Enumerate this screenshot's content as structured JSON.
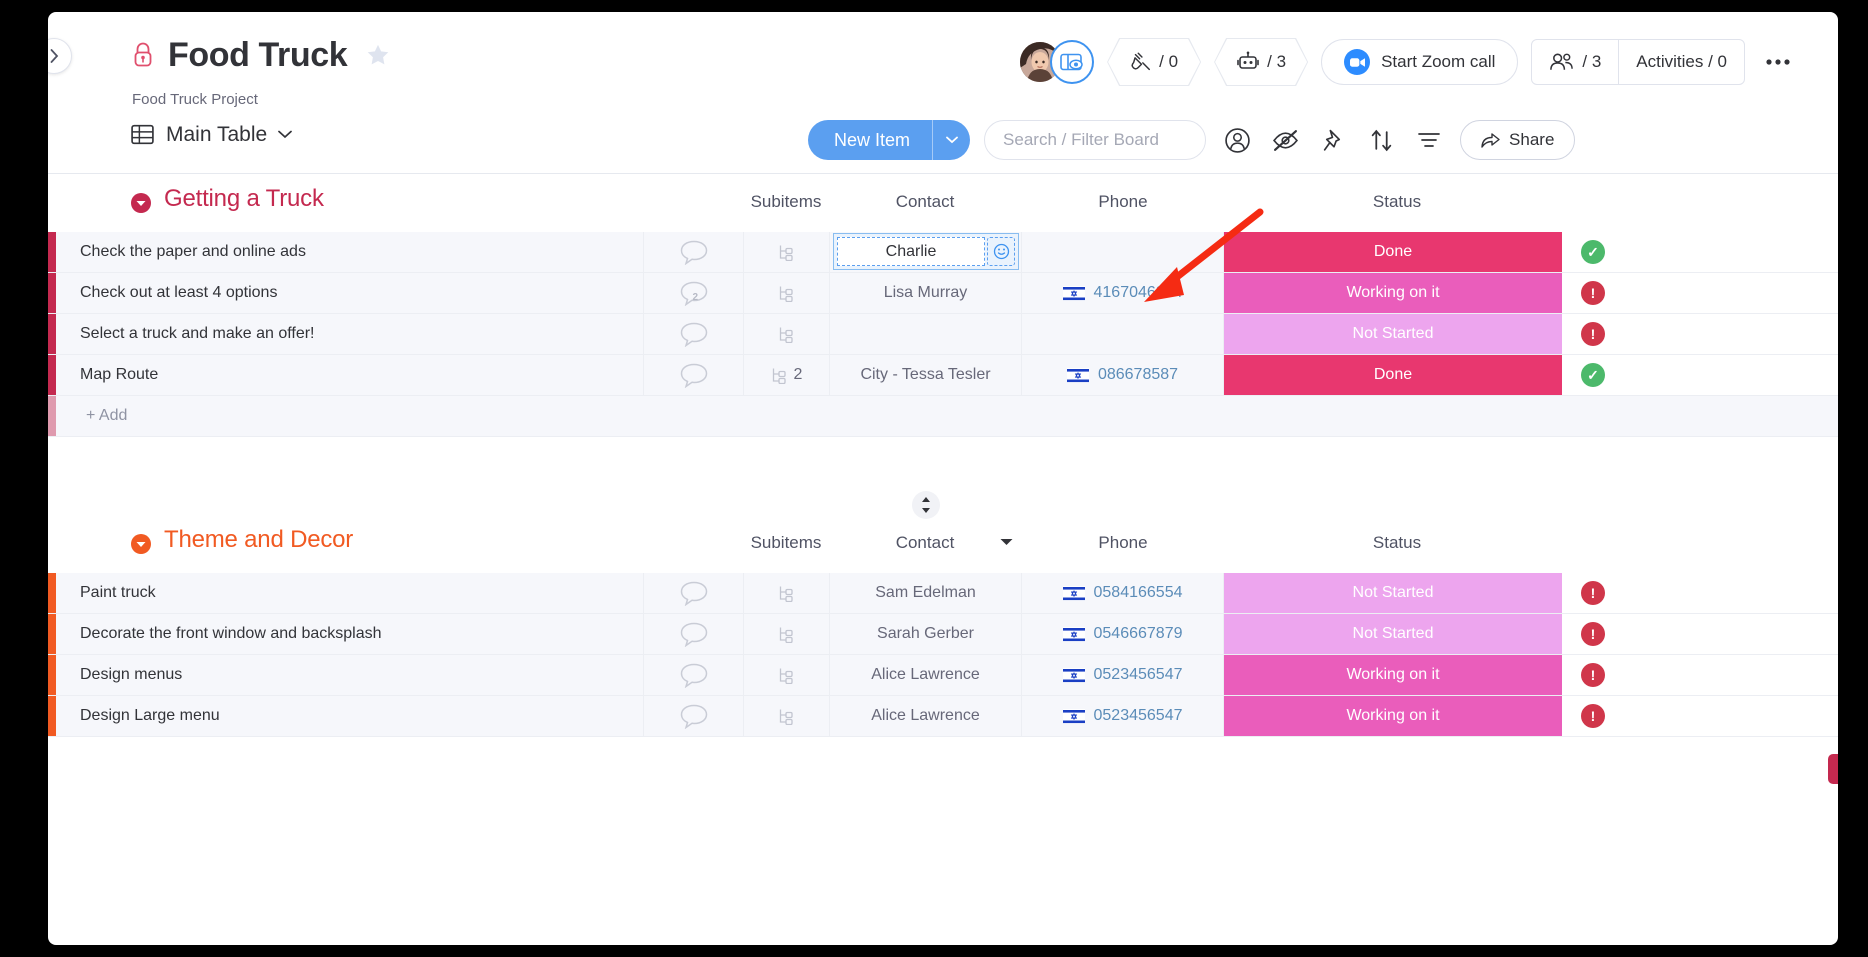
{
  "header": {
    "collapse_icon": "chevron-right-icon",
    "lock_icon": "lock-icon",
    "title": "Food Truck",
    "star_icon": "star-icon",
    "subtitle": "Food Truck Project",
    "avatar_icon": "user-avatar",
    "view_badge_icon": "board-view-eye-icon",
    "integrations": {
      "icon": "plug-icon",
      "label": "/ 0"
    },
    "automations": {
      "icon": "robot-icon",
      "label": "/ 3"
    },
    "zoom_call": {
      "icon": "video-camera-icon",
      "label": "Start Zoom call"
    },
    "people": {
      "icon": "people-icon",
      "label": "/ 3"
    },
    "activities": {
      "label": "Activities / 0"
    },
    "more_icon": "ellipsis-icon"
  },
  "toolbar": {
    "view_icon": "table-grid-icon",
    "view_label": "Main Table",
    "view_caret_icon": "chevron-down-icon",
    "new_item_label": "New Item",
    "new_item_caret_icon": "chevron-down-icon",
    "search_placeholder": "Search / Filter Board",
    "search_value": "",
    "person_icon": "person-circle-icon",
    "hide_icon": "eye-slash-icon",
    "pin_icon": "pin-icon",
    "sort_icon": "sort-icon",
    "filter_icon": "filter-icon",
    "share_icon": "share-arrow-icon",
    "share_label": "Share"
  },
  "columns": {
    "subitems": "Subitems",
    "contact": "Contact",
    "phone": "Phone",
    "status": "Status"
  },
  "colors": {
    "group_1": "#c4294f",
    "group_2": "#f15a22",
    "status_done": "#e8376f",
    "status_working": "#ea5dbb",
    "status_not_started": "#eda5ee",
    "accent_blue": "#5b9ff0",
    "indicator_done": "#4cb96b",
    "indicator_alert": "#d0364a"
  },
  "groups": [
    {
      "name": "Getting a Truck",
      "color": "#c4294f",
      "caret_icon": "collapse-caret-icon",
      "sort_handle": false,
      "add_label": "+ Add",
      "rows": [
        {
          "name": "Check the paper and online ads",
          "chat_icon": "chat-bubble-icon",
          "chat_count": "",
          "subitem_icon": "subitem-tree-icon",
          "subitem_count": "",
          "contact": "Charlie",
          "contact_editing": true,
          "contact_emoji_icon": "smiley-icon",
          "phone": "",
          "phone_flag_icon": "",
          "status": "Done",
          "status_color": "#e8376f",
          "indicator": "done"
        },
        {
          "name": "Check out at least 4 options",
          "chat_icon": "chat-bubble-icon",
          "chat_count": "2",
          "subitem_icon": "subitem-tree-icon",
          "subitem_count": "",
          "contact": "Lisa Murray",
          "contact_editing": false,
          "phone": "4167046964",
          "phone_flag_icon": "israel-flag-icon",
          "status": "Working on it",
          "status_color": "#ea5dbb",
          "indicator": "alert"
        },
        {
          "name": "Select a truck and make an offer!",
          "chat_icon": "chat-bubble-icon",
          "chat_count": "",
          "subitem_icon": "subitem-tree-icon",
          "subitem_count": "",
          "contact": "",
          "contact_editing": false,
          "phone": "",
          "phone_flag_icon": "",
          "status": "Not Started",
          "status_color": "#eda5ee",
          "indicator": "alert"
        },
        {
          "name": "Map Route",
          "chat_icon": "chat-bubble-icon",
          "chat_count": "",
          "subitem_icon": "subitem-tree-icon",
          "subitem_count": "2",
          "contact": "City - Tessa Tesler",
          "contact_editing": false,
          "phone": "086678587",
          "phone_flag_icon": "israel-flag-icon",
          "status": "Done",
          "status_color": "#e8376f",
          "indicator": "done"
        }
      ]
    },
    {
      "name": "Theme and Decor",
      "color": "#f15a22",
      "caret_icon": "collapse-caret-icon",
      "sort_handle": true,
      "sort_handle_icon": "sort-updown-icon",
      "column_caret_icon": "chevron-down-icon",
      "add_label": "",
      "rows": [
        {
          "name": "Paint truck",
          "chat_icon": "chat-bubble-icon",
          "chat_count": "",
          "subitem_icon": "subitem-tree-icon",
          "subitem_count": "",
          "contact": "Sam Edelman",
          "contact_editing": false,
          "phone": "0584166554",
          "phone_flag_icon": "israel-flag-icon",
          "status": "Not Started",
          "status_color": "#eda5ee",
          "indicator": "alert"
        },
        {
          "name": "Decorate the front window and backsplash",
          "chat_icon": "chat-bubble-icon",
          "chat_count": "",
          "subitem_icon": "subitem-tree-icon",
          "subitem_count": "",
          "contact": "Sarah Gerber",
          "contact_editing": false,
          "phone": "0546667879",
          "phone_flag_icon": "israel-flag-icon",
          "status": "Not Started",
          "status_color": "#eda5ee",
          "indicator": "alert"
        },
        {
          "name": "Design menus",
          "chat_icon": "chat-bubble-icon",
          "chat_count": "",
          "subitem_icon": "subitem-tree-icon",
          "subitem_count": "",
          "contact": "Alice Lawrence",
          "contact_editing": false,
          "phone": "0523456547",
          "phone_flag_icon": "israel-flag-icon",
          "status": "Working on it",
          "status_color": "#ea5dbb",
          "indicator": "alert"
        },
        {
          "name": "Design Large menu",
          "chat_icon": "chat-bubble-icon",
          "chat_count": "",
          "subitem_icon": "subitem-tree-icon",
          "subitem_count": "",
          "contact": "Alice Lawrence",
          "contact_editing": false,
          "phone": "0523456547",
          "phone_flag_icon": "israel-flag-icon",
          "status": "Working on it",
          "status_color": "#ea5dbb",
          "indicator": "alert"
        }
      ]
    }
  ],
  "annotation": {
    "arrow_icon": "red-pointer-arrow",
    "color": "#f52b13"
  }
}
